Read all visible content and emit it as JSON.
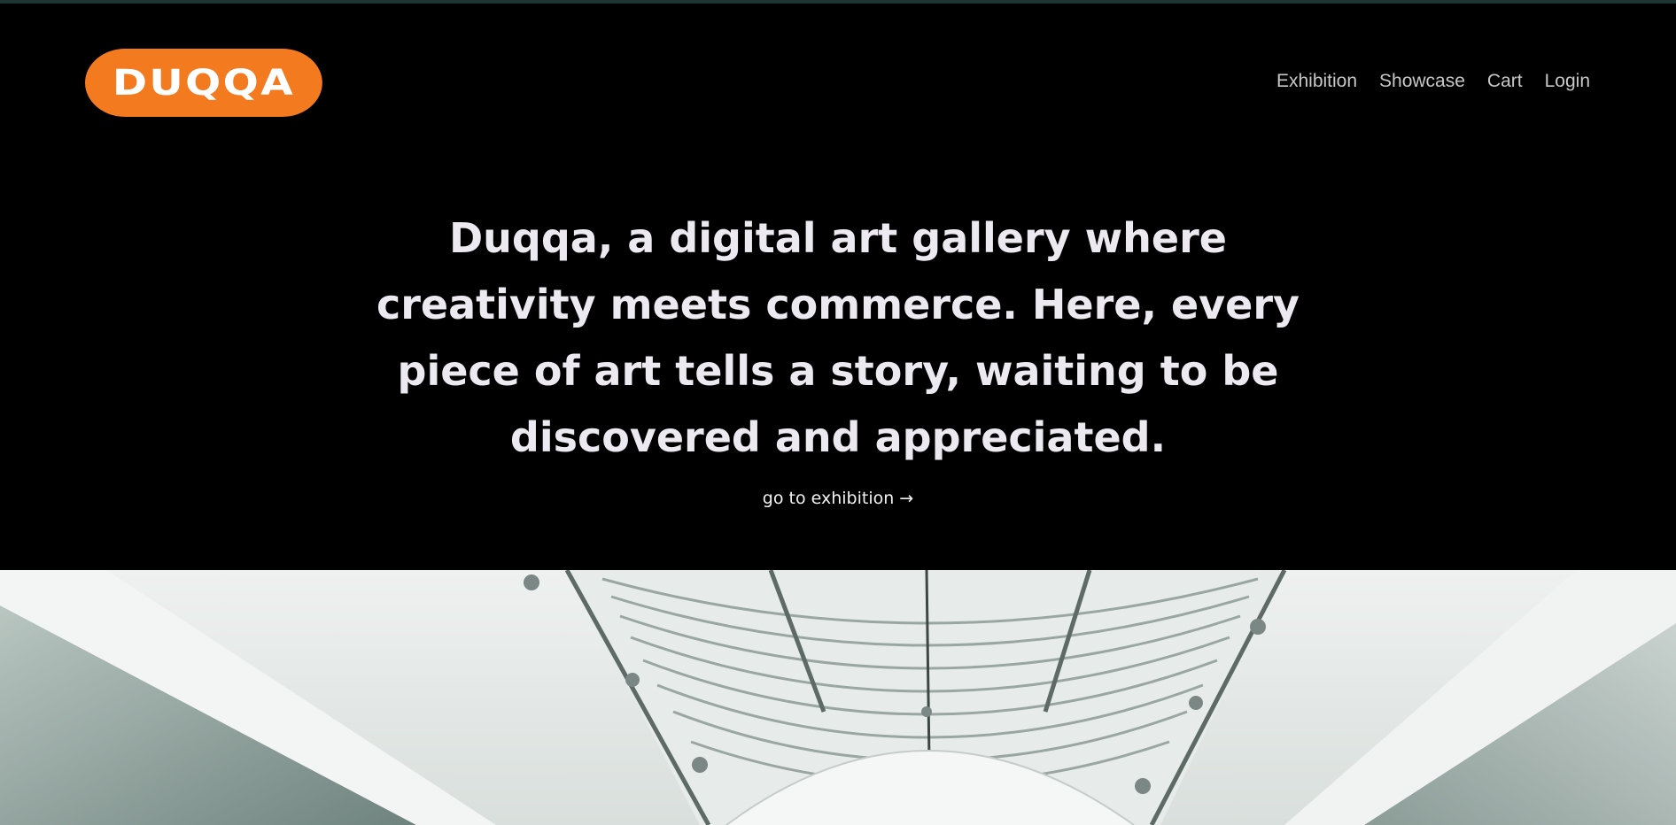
{
  "brand": {
    "logo_text": "DUQQA",
    "accent_color": "#f47a20"
  },
  "nav": {
    "items": [
      {
        "label": "Exhibition"
      },
      {
        "label": "Showcase"
      },
      {
        "label": "Cart"
      },
      {
        "label": "Login"
      }
    ]
  },
  "hero": {
    "headline": "Duqqa, a digital art gallery where creativity meets commerce. Here, every piece of art tells a story, waiting to be discovered and appreciated.",
    "cta_label": "go to exhibition →"
  },
  "colors": {
    "background": "#000000",
    "text": "#eceaf0",
    "nav_text": "#c8c8c8"
  }
}
